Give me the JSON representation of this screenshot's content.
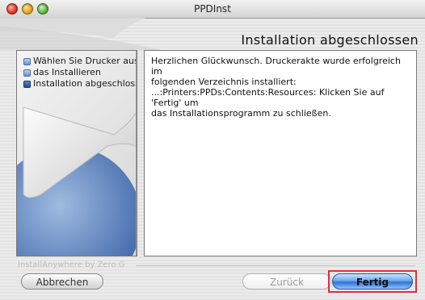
{
  "window": {
    "title": "PPDInst"
  },
  "header": {
    "title": "Installation abgeschlossen"
  },
  "steps": [
    {
      "label": "Wählen Sie Drucker aus",
      "state": "done"
    },
    {
      "label": "das Installieren",
      "state": "done"
    },
    {
      "label": "Installation abgeschlossen",
      "state": "current"
    }
  ],
  "content": {
    "lines": [
      "Herzlichen Glückwunsch. Druckerakte wurde erfolgreich im",
      "folgenden Verzeichnis installiert:",
      "...:Printers:PPDs:Contents:Resources:  Klicken Sie auf 'Fertig' um",
      "das Installationsprogramm zu schließen."
    ]
  },
  "branding": "InstallAnywhere by Zero G",
  "buttons": {
    "cancel": "Abbrechen",
    "back": "Zurück",
    "finish": "Fertig"
  },
  "colors": {
    "highlight": "#e0303b",
    "accent_blue": "#2f73d2"
  }
}
